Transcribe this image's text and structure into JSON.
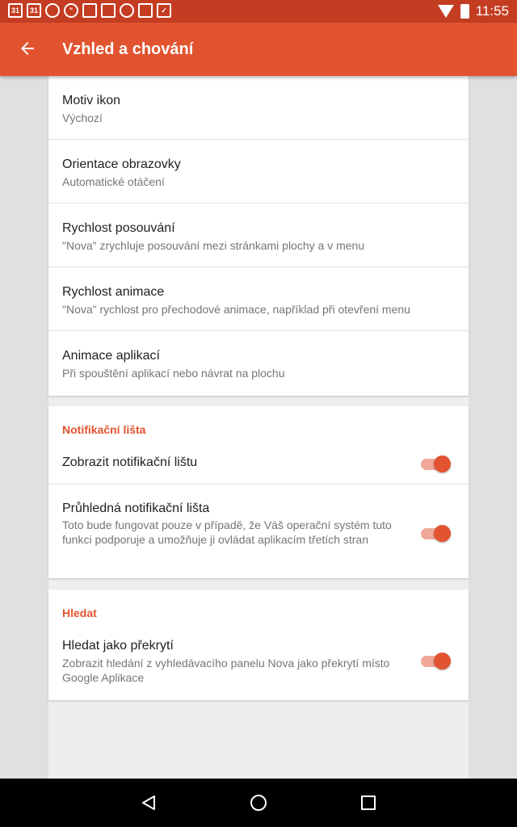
{
  "status_bar": {
    "time": "11:55",
    "left_icons": [
      "calendar-icon",
      "calendar-icon",
      "pie-chart-icon",
      "hangouts-icon",
      "image-icon",
      "news-icon",
      "soccer-icon",
      "clipboard-icon",
      "clipboard-check-icon"
    ],
    "calendar_text": "31"
  },
  "app_bar": {
    "title": "Vzhled a chování",
    "back_icon": "arrow-back-icon",
    "color": "#e2532f"
  },
  "general": {
    "items": [
      {
        "title": "Motiv ikon",
        "subtitle": "Výchozí"
      },
      {
        "title": "Orientace obrazovky",
        "subtitle": "Automatické otáčení"
      },
      {
        "title": "Rychlost posouvání",
        "subtitle": "\"Nova\" zrychluje posouvání mezi stránkami plochy a v menu"
      },
      {
        "title": "Rychlost animace",
        "subtitle": "\"Nova\" rychlost pro přechodové animace, například při otevření menu"
      },
      {
        "title": "Animace aplikací",
        "subtitle": "Při spouštění aplikací nebo návrat na plochu"
      }
    ]
  },
  "notification_section": {
    "header": "Notifikační lišta",
    "items": [
      {
        "title": "Zobrazit notifikační lištu",
        "subtitle": "",
        "enabled": true
      },
      {
        "title": "Průhledná notifikační lišta",
        "subtitle": "Toto bude fungovat pouze v případě, že Váš operační systém tuto funkci podporuje a umožňuje ji ovládat aplikacím třetích stran",
        "enabled": true
      }
    ]
  },
  "search_section": {
    "header": "Hledat",
    "items": [
      {
        "title": "Hledat jako překrytí",
        "subtitle": "Zobrazit hledání z vyhledávacího panelu Nova jako překrytí místo Google Aplikace",
        "enabled": true
      }
    ]
  },
  "nav_bar": {
    "buttons": [
      "back-icon",
      "home-icon",
      "recents-icon"
    ]
  },
  "colors": {
    "accent": "#e2532f",
    "status_bar": "#c43d22",
    "toggle_track": "#f0a899"
  }
}
